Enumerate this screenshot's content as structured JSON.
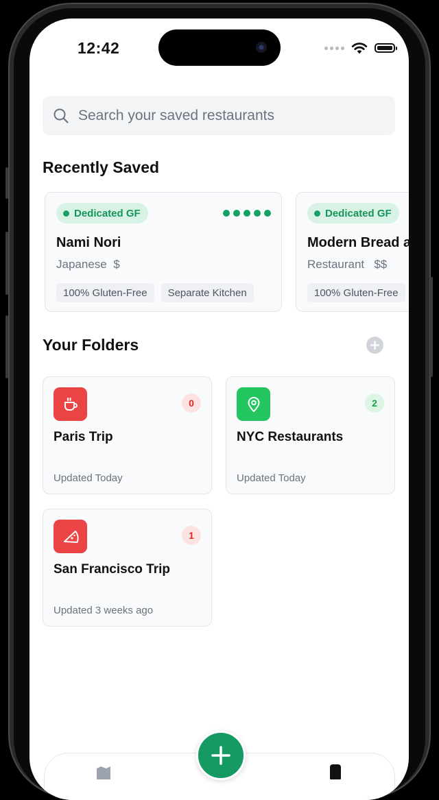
{
  "status_bar": {
    "time": "12:42"
  },
  "search": {
    "placeholder": "Search your saved restaurants"
  },
  "recently_saved": {
    "title": "Recently Saved",
    "cards": [
      {
        "badge": "Dedicated GF",
        "rating": 5,
        "name": "Nami Nori",
        "cuisine": "Japanese",
        "price": "$",
        "tags": [
          "100% Gluten-Free",
          "Separate Kitchen"
        ]
      },
      {
        "badge": "Dedicated GF",
        "name": "Modern Bread and Bagel",
        "cuisine": "Restaurant",
        "price": "$$",
        "tags": [
          "100% Gluten-Free"
        ]
      }
    ]
  },
  "folders": {
    "title": "Your Folders",
    "items": [
      {
        "name": "Paris Trip",
        "count": "0",
        "updated": "Updated Today",
        "icon": "coffee-icon",
        "color": "#ea4444"
      },
      {
        "name": "NYC Restaurants",
        "count": "2",
        "updated": "Updated Today",
        "icon": "location-pin-icon",
        "color": "#22c55e"
      },
      {
        "name": "San Francisco Trip",
        "count": "1",
        "updated": "Updated 3 weeks ago",
        "icon": "pizza-icon",
        "color": "#ea4444"
      }
    ]
  },
  "tab_bar": {
    "tabs": [
      {
        "icon": "map-icon"
      },
      {
        "icon": "phone-icon"
      }
    ]
  },
  "colors": {
    "accent": "#15a065",
    "red": "#ea4444",
    "green": "#22c55e"
  }
}
